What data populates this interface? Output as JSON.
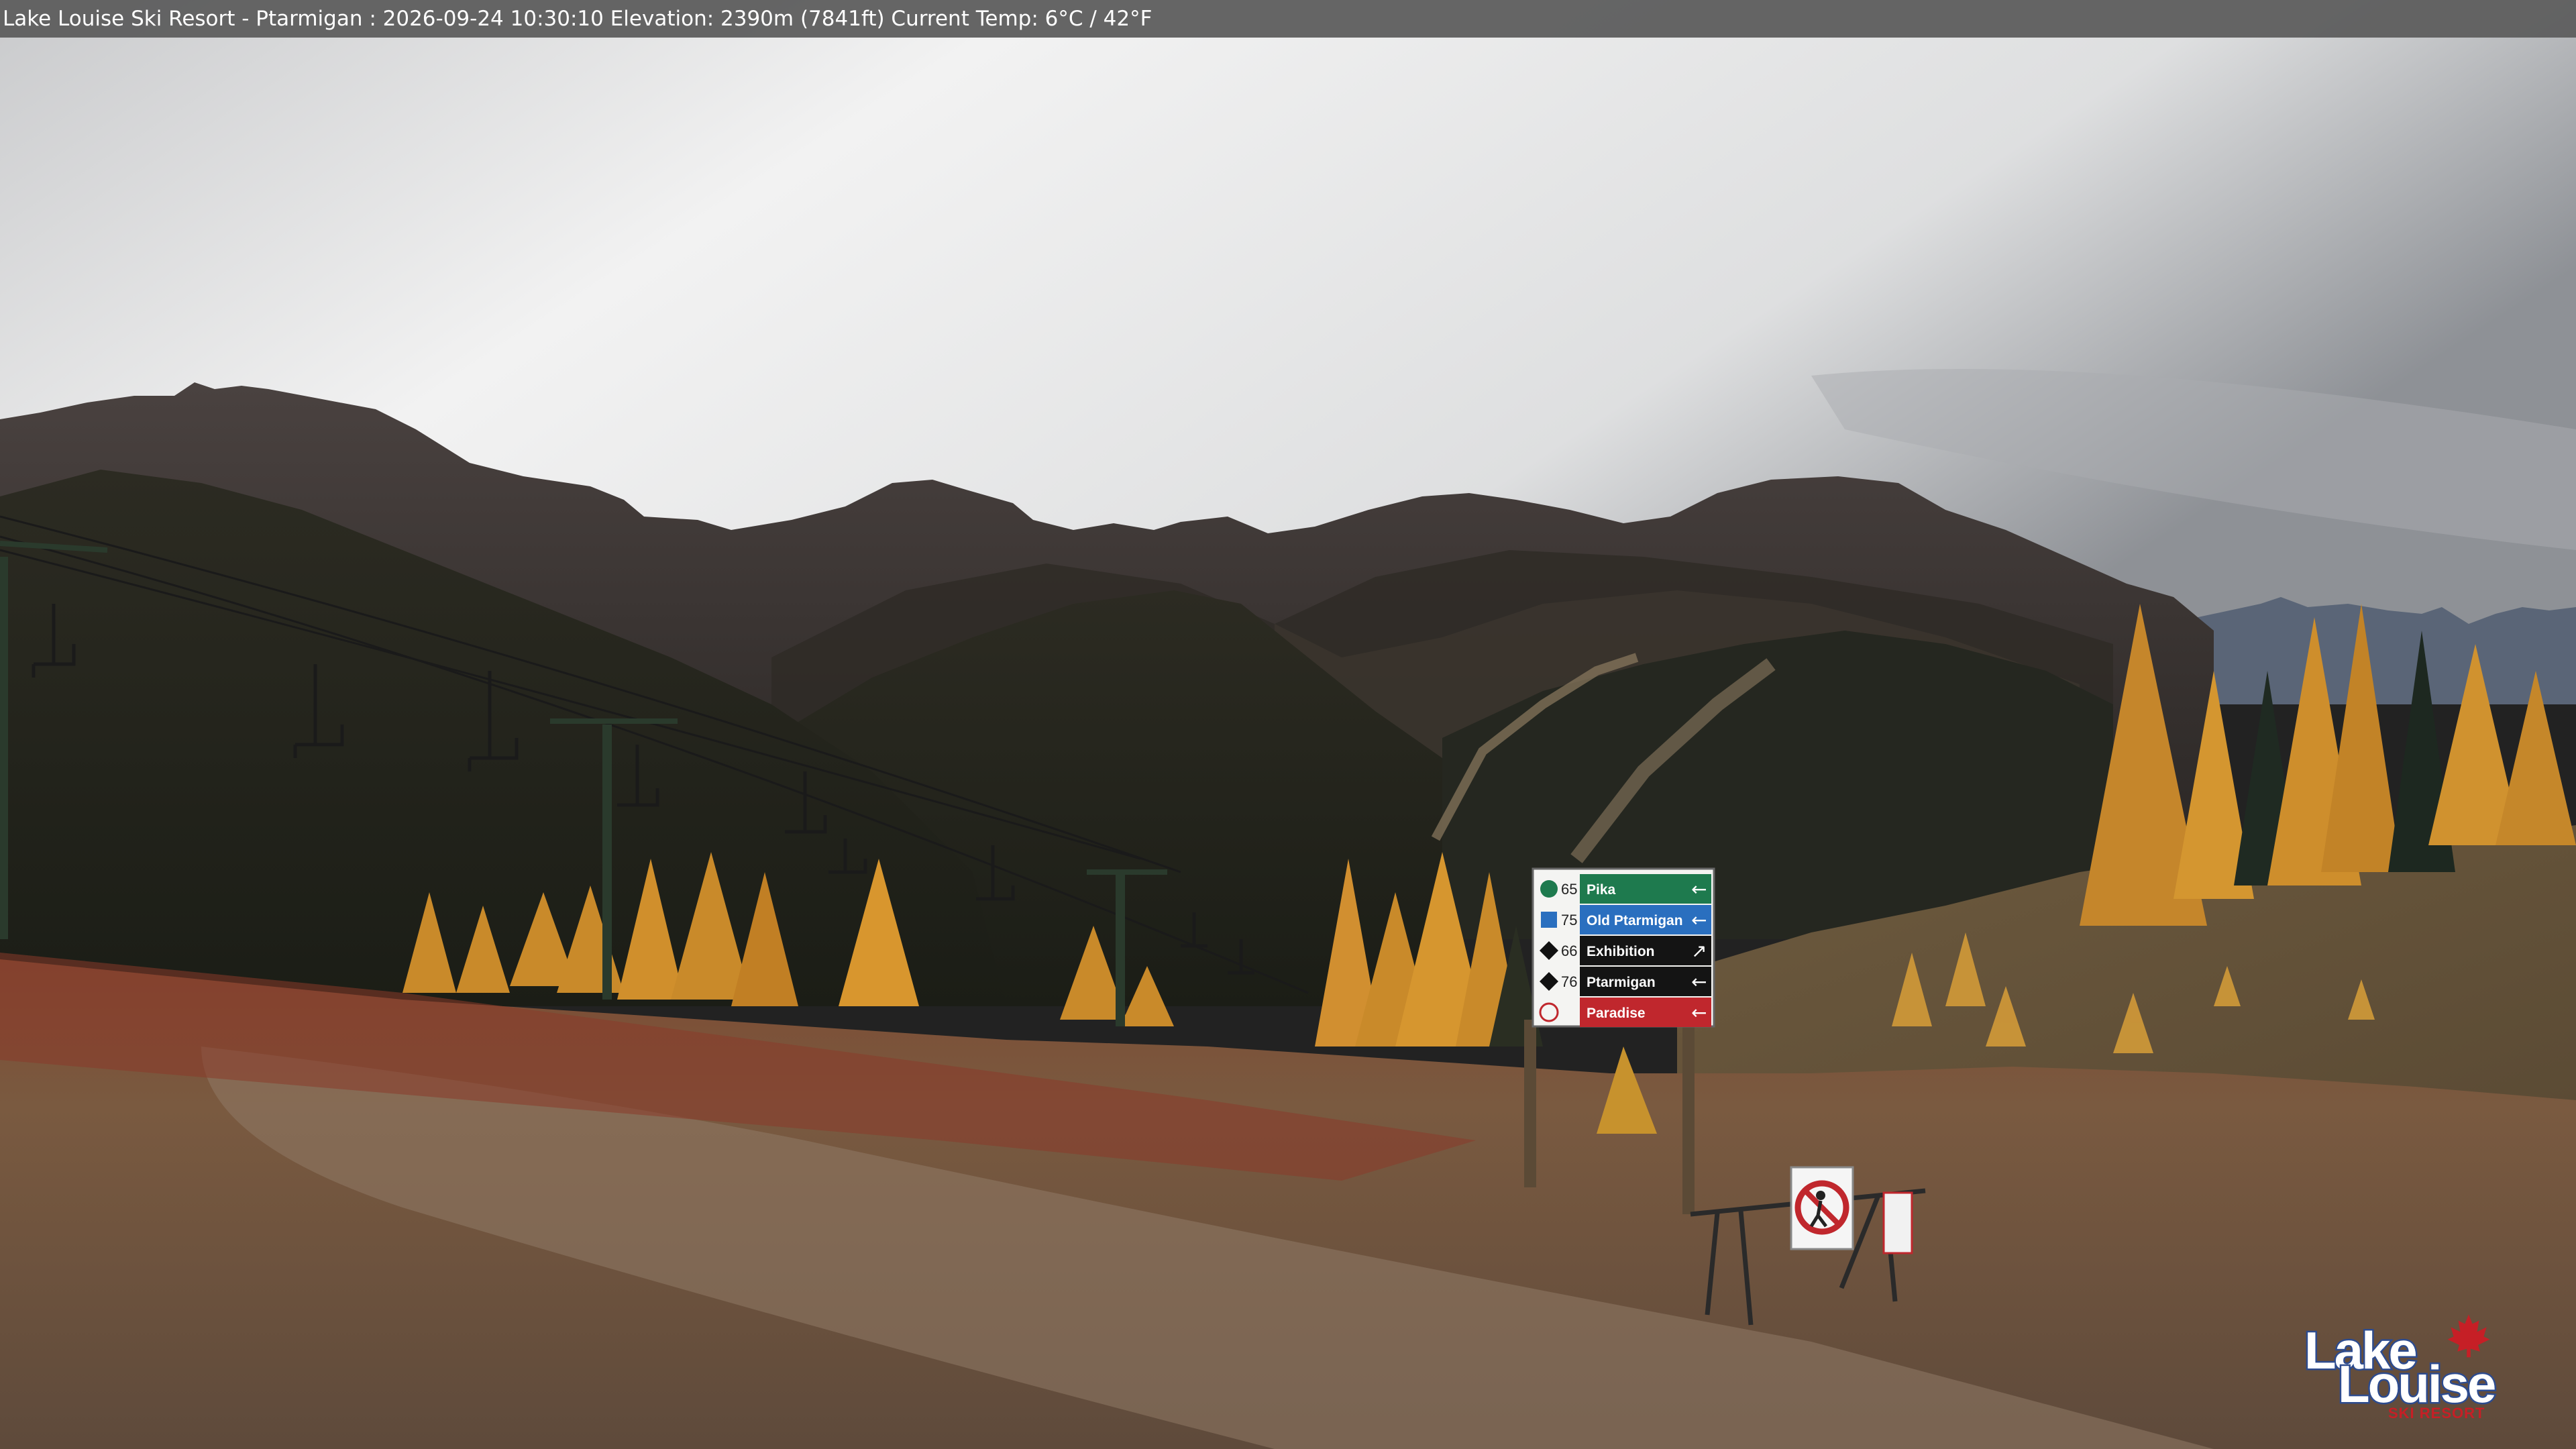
{
  "overlay": {
    "caption": "Lake Louise Ski Resort - Ptarmigan : 2026-09-24 10:30:10  Elevation: 2390m (7841ft) Current Temp: 6°C / 42°F"
  },
  "trail_sign": {
    "rows": [
      {
        "number": "65",
        "name": "Pika",
        "arrow": "←",
        "color": "#1e7a4e",
        "symbol": "green-circle-icon"
      },
      {
        "number": "75",
        "name": "Old Ptarmigan",
        "arrow": "←",
        "color": "#2a6fbf",
        "symbol": "blue-square-icon"
      },
      {
        "number": "66",
        "name": "Exhibition",
        "arrow": "↗",
        "color": "#141414",
        "symbol": "black-diamond-icon"
      },
      {
        "number": "76",
        "name": "Ptarmigan",
        "arrow": "←",
        "color": "#141414",
        "symbol": "black-diamond-icon"
      },
      {
        "number": "",
        "name": "Paradise",
        "arrow": "←",
        "color": "#c0272d",
        "symbol": "lift-icon"
      }
    ]
  },
  "logo": {
    "line1": "Lake",
    "line2": "Louise",
    "tagline": "SKI RESORT"
  },
  "colors": {
    "sky": "#d8d9da",
    "mountain": "#3b3533",
    "larch": "#c98a2a",
    "ground": "#8a6b4e",
    "logo_blue": "#2d4b8e",
    "logo_red": "#c61f26"
  }
}
